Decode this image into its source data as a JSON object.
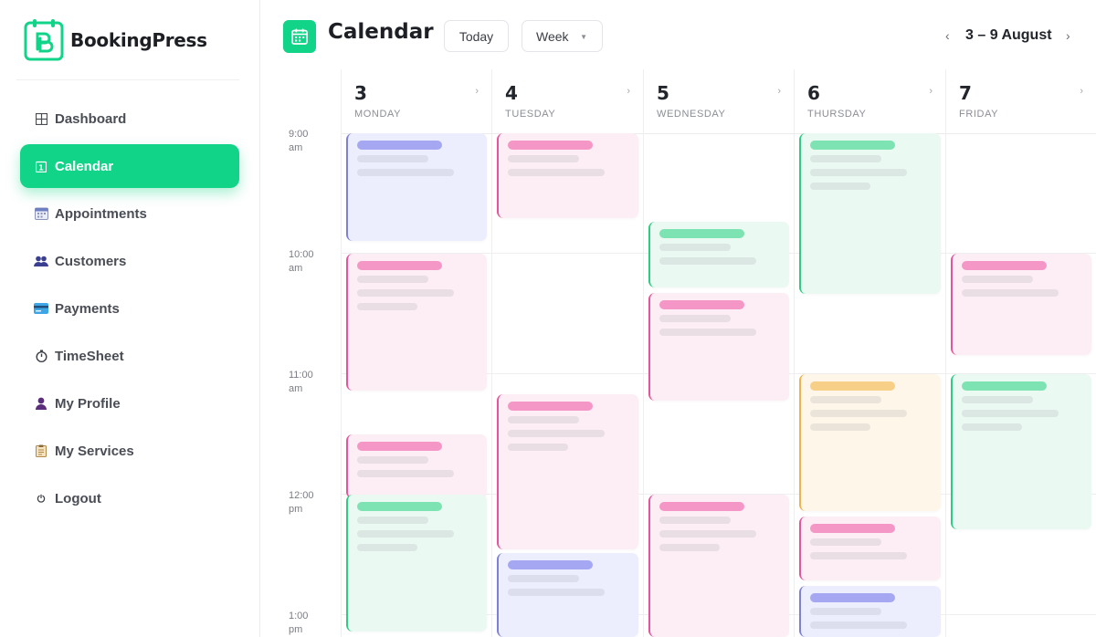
{
  "brand": {
    "name": "BookingPress"
  },
  "sidebar": {
    "items": [
      {
        "label": "Dashboard",
        "icon": "grid-icon",
        "active": false
      },
      {
        "label": "Calendar",
        "icon": "calendar-icon",
        "active": true
      },
      {
        "label": "Appointments",
        "icon": "appointments-calendar-icon",
        "active": false
      },
      {
        "label": "Customers",
        "icon": "customers-icon",
        "active": false
      },
      {
        "label": "Payments",
        "icon": "credit-card-icon",
        "active": false
      },
      {
        "label": "TimeSheet",
        "icon": "stopwatch-icon",
        "active": false
      },
      {
        "label": "My Profile",
        "icon": "user-icon",
        "active": false
      },
      {
        "label": "My Services",
        "icon": "clipboard-icon",
        "active": false
      },
      {
        "label": "Logout",
        "icon": "logout-icon",
        "active": false
      }
    ]
  },
  "header": {
    "title": "Calendar",
    "today_label": "Today",
    "view_label": "Week",
    "range_label": "3 – 9 August",
    "prev_icon": "chevron-left-icon",
    "next_icon": "chevron-right-icon"
  },
  "calendar": {
    "days": [
      {
        "num": "3",
        "name": "MONDAY"
      },
      {
        "num": "4",
        "name": "TUESDAY"
      },
      {
        "num": "5",
        "name": "WEDNESDAY"
      },
      {
        "num": "6",
        "name": "THURSDAY"
      },
      {
        "num": "7",
        "name": "FRIDAY"
      }
    ],
    "times": [
      {
        "t": "9:00",
        "ap": "am"
      },
      {
        "t": "10:00",
        "ap": "am"
      },
      {
        "t": "11:00",
        "ap": "am"
      },
      {
        "t": "12:00",
        "ap": "pm"
      },
      {
        "t": "1:00",
        "ap": "pm"
      }
    ]
  },
  "colors": {
    "accent": "#12d488",
    "purple": "#a5a7f3",
    "pink": "#f597c6",
    "green": "#7ee3b2",
    "orange": "#f8cf86"
  }
}
